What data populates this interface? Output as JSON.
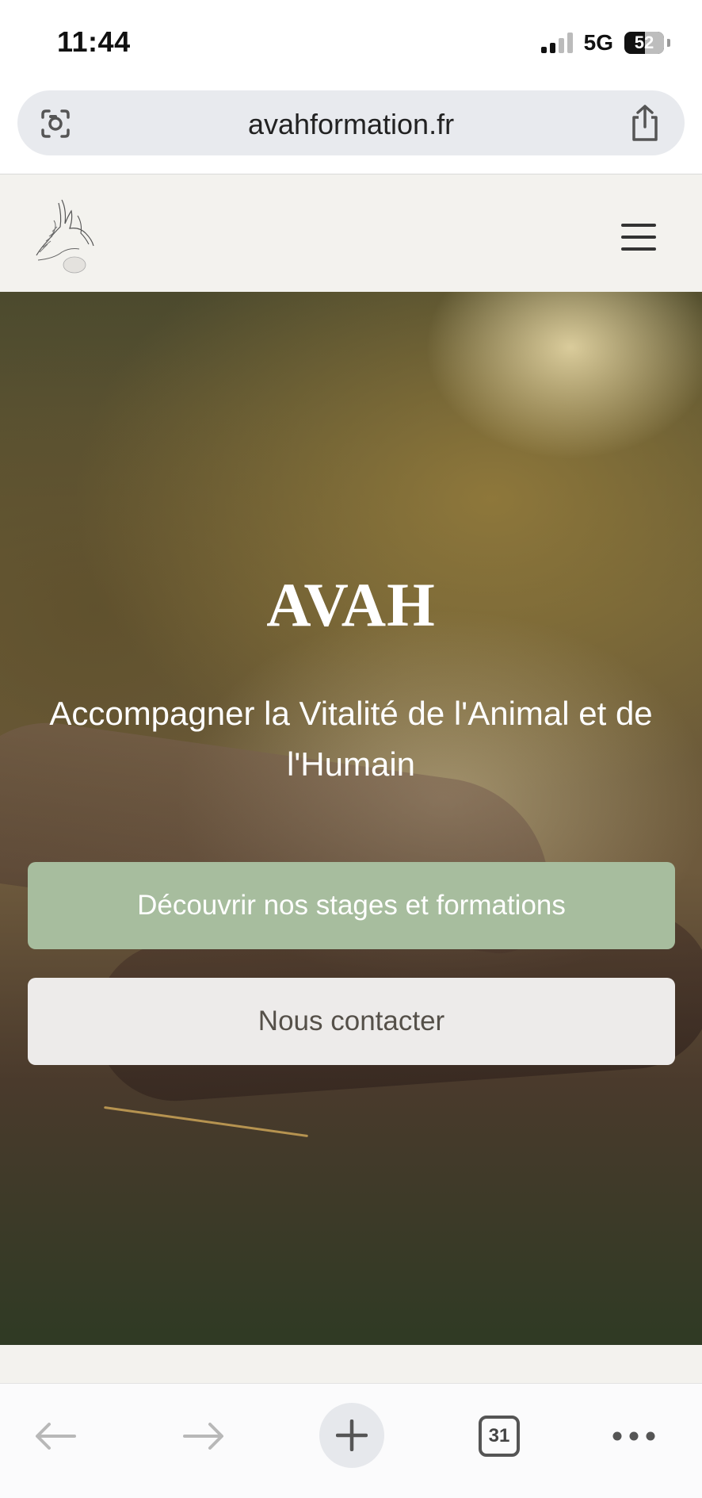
{
  "status_bar": {
    "time": "11:44",
    "network": "5G",
    "battery": "52"
  },
  "browser": {
    "url": "avahformation.fr"
  },
  "hero": {
    "title": "AVAH",
    "subtitle": "Accompagner la Vitalité de l'Animal et de l'Humain",
    "primary_button": "Découvrir nos stages et formations",
    "secondary_button": "Nous contacter"
  },
  "toolbar": {
    "tab_count": "31"
  },
  "colors": {
    "header_bg": "#f3f2ee",
    "primary_button": "#a7bd9e",
    "secondary_button": "#edebea",
    "urlbar_bg": "#e8eaee"
  },
  "icons": [
    "lens-icon",
    "share-icon",
    "menu-icon",
    "back-arrow-icon",
    "forward-arrow-icon",
    "plus-icon",
    "tabs-icon",
    "more-icon"
  ]
}
